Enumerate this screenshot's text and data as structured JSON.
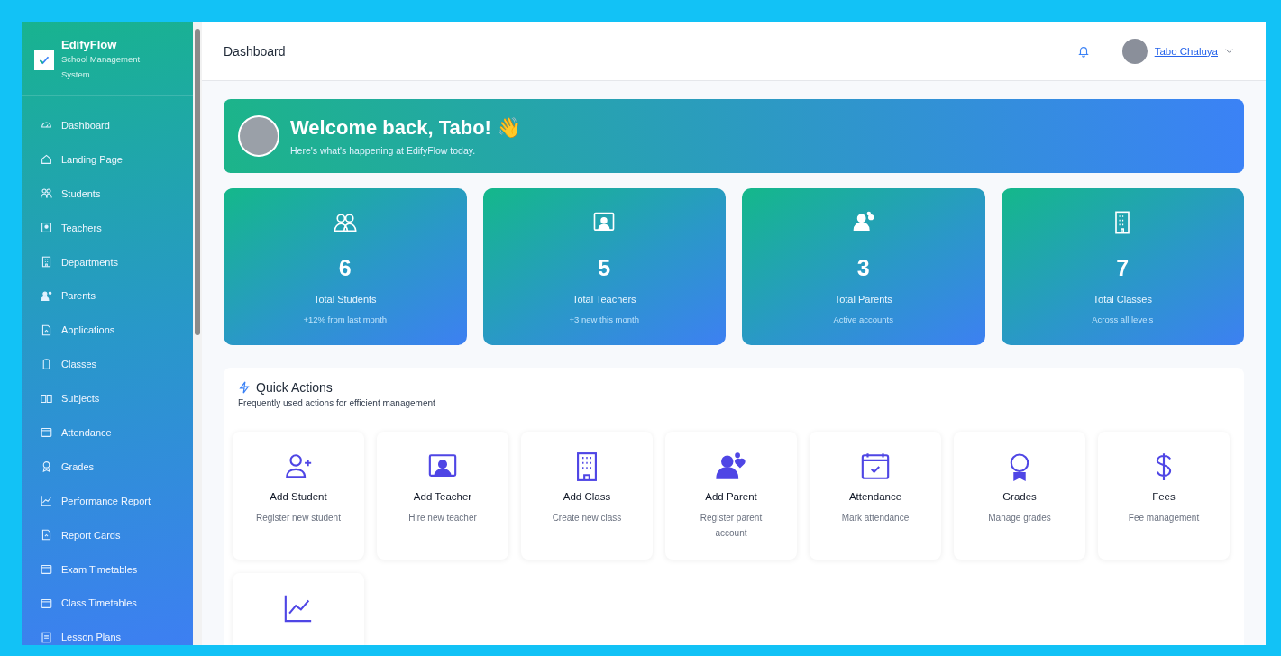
{
  "sidebar": {
    "brand": {
      "name": "EdifyFlow",
      "tagline": "School Management System"
    },
    "items": [
      {
        "label": "Dashboard"
      },
      {
        "label": "Landing Page"
      },
      {
        "label": "Students"
      },
      {
        "label": "Teachers"
      },
      {
        "label": "Departments"
      },
      {
        "label": "Parents"
      },
      {
        "label": "Applications"
      },
      {
        "label": "Classes"
      },
      {
        "label": "Subjects"
      },
      {
        "label": "Attendance"
      },
      {
        "label": "Grades"
      },
      {
        "label": "Performance Report"
      },
      {
        "label": "Report Cards"
      },
      {
        "label": "Exam Timetables"
      },
      {
        "label": "Class Timetables"
      },
      {
        "label": "Lesson Plans"
      }
    ]
  },
  "header": {
    "title": "Dashboard",
    "user": "Tabo Chaluya"
  },
  "welcome": {
    "title": "Welcome back, Tabo! 👋",
    "subtitle": "Here's what's happening at EdifyFlow today."
  },
  "stats": [
    {
      "value": "6",
      "label": "Total Students",
      "note": "+12% from last month"
    },
    {
      "value": "5",
      "label": "Total Teachers",
      "note": "+3 new this month"
    },
    {
      "value": "3",
      "label": "Total Parents",
      "note": "Active accounts"
    },
    {
      "value": "7",
      "label": "Total Classes",
      "note": "Across all levels"
    }
  ],
  "quick_actions": {
    "title": "Quick Actions",
    "subtitle": "Frequently used actions for efficient management",
    "items": [
      {
        "kind": "full",
        "title": "Add Student",
        "description": "Register new student"
      },
      {
        "kind": "full",
        "title": "Add Teacher",
        "description": "Hire new teacher"
      },
      {
        "kind": "full",
        "title": "Add Class",
        "description": "Create new class"
      },
      {
        "kind": "full",
        "title": "Add Parent",
        "description": "Register parent account"
      },
      {
        "kind": "full",
        "title": "Attendance",
        "description": "Mark attendance"
      },
      {
        "kind": "full",
        "title": "Grades",
        "description": "Manage grades"
      },
      {
        "kind": "full",
        "title": "Fees",
        "description": "Fee management"
      },
      {
        "kind": "cut"
      }
    ]
  }
}
